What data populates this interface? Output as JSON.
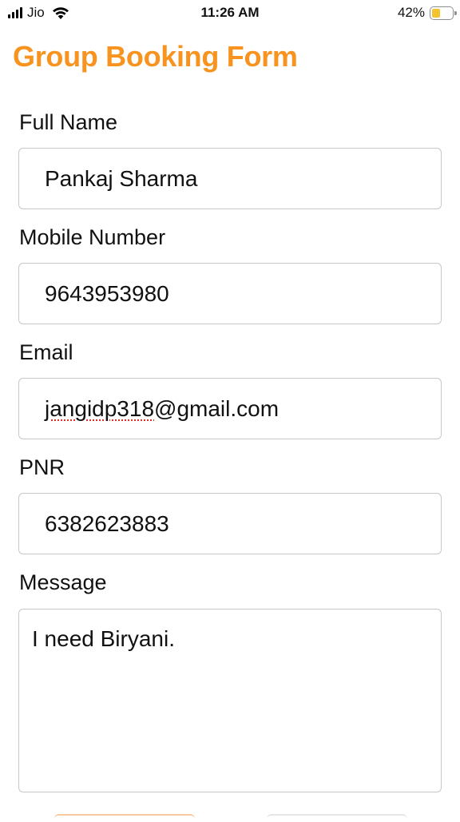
{
  "status_bar": {
    "carrier": "Jio",
    "time": "11:26 AM",
    "battery_percent": "42%",
    "battery_level": 0.42,
    "battery_color": "#f4c430",
    "icons": [
      "signal-icon",
      "wifi-icon",
      "battery-icon"
    ]
  },
  "form": {
    "title": "Group Booking Form",
    "title_color": "#f7931e",
    "full_name": {
      "label": "Full Name",
      "value": "Pankaj Sharma"
    },
    "mobile": {
      "label": "Mobile Number",
      "value": "9643953980"
    },
    "email": {
      "label": "Email",
      "value_misspelled_part": "jangidp318",
      "value_rest": "@gmail.com"
    },
    "pnr": {
      "label": "PNR",
      "value": "6382623883"
    },
    "message": {
      "label": "Message",
      "value": "I need Biryani."
    }
  }
}
